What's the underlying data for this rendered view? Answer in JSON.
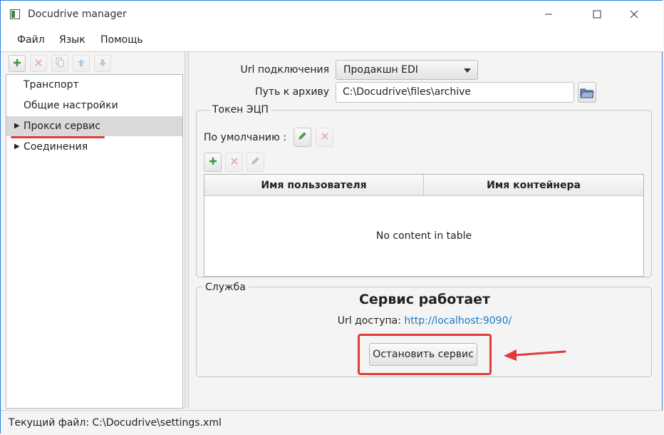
{
  "window": {
    "title": "Docudrive manager"
  },
  "menu": {
    "items": [
      "Файл",
      "Язык",
      "Помощь"
    ]
  },
  "tree": {
    "items": [
      {
        "label": "Транспорт",
        "expandable": false,
        "selected": false
      },
      {
        "label": "Общие настройки",
        "expandable": false,
        "selected": false
      },
      {
        "label": "Прокси сервис",
        "expandable": true,
        "selected": true
      },
      {
        "label": "Соединения",
        "expandable": true,
        "selected": false
      }
    ]
  },
  "settings": {
    "url_label": "Url подключения",
    "url_value": "Продакшн EDI",
    "archive_label": "Путь к архиву",
    "archive_value": "C:\\Docudrive\\files\\archive"
  },
  "token": {
    "group_title": "Токен ЭЦП",
    "default_label": "По умолчанию :",
    "columns": [
      "Имя пользователя",
      "Имя контейнера"
    ],
    "rows": [],
    "empty_text": "No content in table"
  },
  "service": {
    "group_title": "Служба",
    "status": "Сервис работает",
    "url_label": "Url доступа:",
    "url": "http://localhost:9090/",
    "stop_button": "Остановить сервис"
  },
  "statusbar": {
    "text": "Текущий файл: C:\\Docudrive\\settings.xml"
  },
  "colors": {
    "accent": "#2b7de9",
    "annotation": "#e23b3b",
    "link": "#1a7ac9",
    "add_green": "#2e9a35",
    "delete_red": "#e06060",
    "arrow_blue": "#5b9bd5"
  },
  "icons": [
    "add-icon",
    "delete-icon",
    "copy-icon",
    "arrow-up-icon",
    "arrow-down-icon",
    "folder-icon",
    "edit-icon",
    "dropdown-arrow-icon",
    "expand-arrow-icon"
  ]
}
